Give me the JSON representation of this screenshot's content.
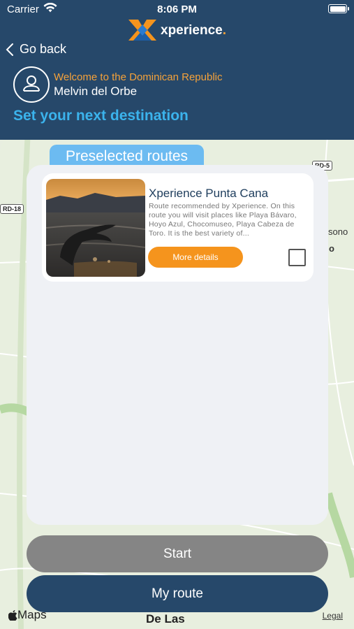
{
  "status_bar": {
    "carrier": "Carrier",
    "time": "8:06 PM"
  },
  "brand": {
    "name": "xperience",
    "dot": ".",
    "accent": "#f5941d",
    "primary": "#26486a"
  },
  "nav": {
    "back_label": "Go back"
  },
  "user": {
    "welcome": "Welcome to the Dominican Republic",
    "name": "Melvin del Orbe"
  },
  "page": {
    "title": "Set your next destination"
  },
  "panel": {
    "tab_label": "Preselected routes"
  },
  "routes": [
    {
      "title": "Xperience Punta Cana",
      "description": "Route recommended by Xperience. On this route you will visit places like Playa Bávaro, Hoyo Azul, Chocomuseo, Playa Cabeza de Toro. It is the best variety of...",
      "details_label": "More details",
      "checked": false
    }
  ],
  "actions": {
    "start_label": "Start",
    "my_route_label": "My route"
  },
  "map": {
    "road_signs": [
      "RD-5",
      "RD-18"
    ],
    "labels": [
      "sono",
      "o",
      "De Las"
    ],
    "attribution": "Maps",
    "legal": "Legal"
  }
}
